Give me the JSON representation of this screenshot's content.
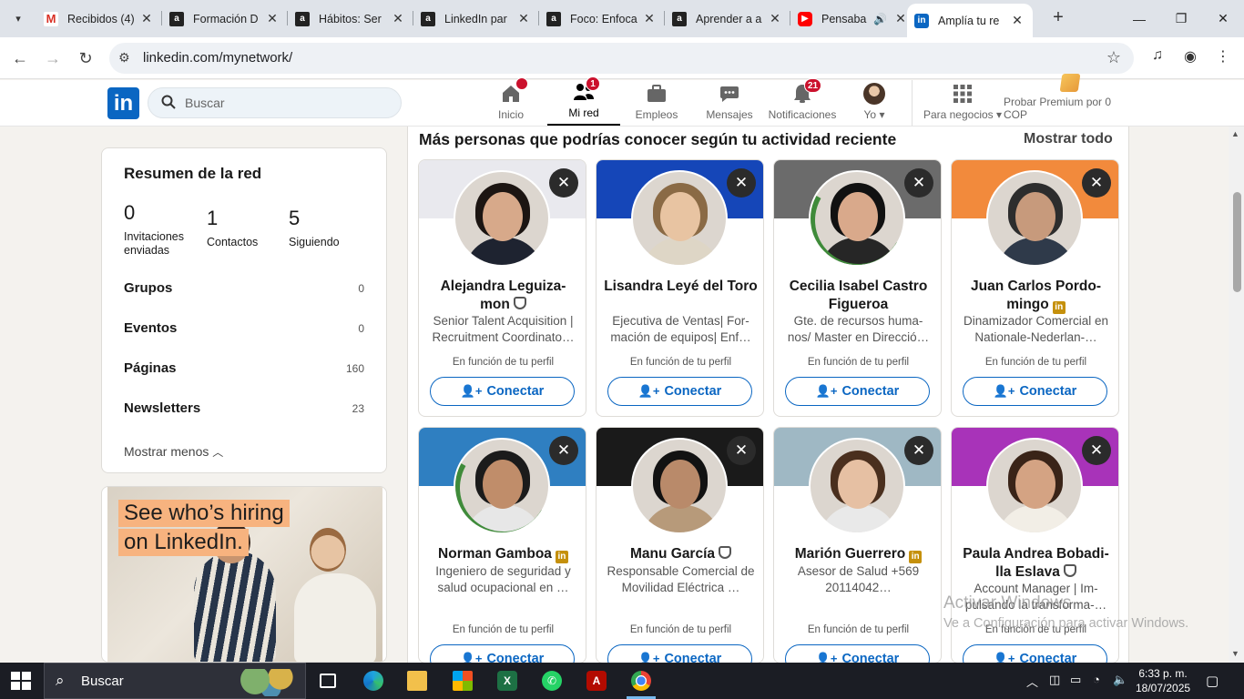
{
  "browser": {
    "tabs": [
      {
        "title": "Recibidos (4)",
        "favicon": "gmail-icon",
        "active": false
      },
      {
        "title": "Formación D",
        "favicon": "academia-icon",
        "active": false
      },
      {
        "title": "Hábitos: Ser",
        "favicon": "academia-icon",
        "active": false
      },
      {
        "title": "LinkedIn par",
        "favicon": "academia-icon",
        "active": false
      },
      {
        "title": "Foco: Enfoca",
        "favicon": "academia-icon",
        "active": false
      },
      {
        "title": "Aprender a a",
        "favicon": "academia-icon",
        "active": false
      },
      {
        "title": "Pensaba",
        "favicon": "youtube-icon",
        "active": false,
        "audio": true
      },
      {
        "title": "Amplía tu re",
        "favicon": "linkedin-icon",
        "active": true
      }
    ],
    "url": "linkedin.com/mynetwork/"
  },
  "linkedin_header": {
    "logo": "in",
    "search_placeholder": "Buscar",
    "nav": [
      {
        "label": "Inicio",
        "icon": "home-icon",
        "badge": "",
        "dot": true
      },
      {
        "label": "Mi red",
        "icon": "network-icon",
        "badge": "1",
        "active": true
      },
      {
        "label": "Empleos",
        "icon": "briefcase-icon",
        "badge": ""
      },
      {
        "label": "Mensajes",
        "icon": "messages-icon",
        "badge": ""
      },
      {
        "label": "Notificaciones",
        "icon": "bell-icon",
        "badge": "21"
      },
      {
        "label": "Yo",
        "icon": "avatar",
        "badge": ""
      }
    ],
    "business_label": "Para negocios",
    "premium_label": "Probar Premium por 0 COP"
  },
  "network_summary": {
    "title": "Resumen de la red",
    "stats": [
      {
        "value": "0",
        "label": "Invitaciones enviadas"
      },
      {
        "value": "1",
        "label": "Contactos"
      },
      {
        "value": "5",
        "label": "Siguiendo"
      }
    ],
    "rows": [
      {
        "label": "Grupos",
        "count": "0"
      },
      {
        "label": "Eventos",
        "count": "0"
      },
      {
        "label": "Páginas",
        "count": "160"
      },
      {
        "label": "Newsletters",
        "count": "23"
      }
    ],
    "show_less": "Mostrar menos"
  },
  "ad": {
    "line1": "See who’s hiring",
    "line2": "on LinkedIn."
  },
  "suggestions": {
    "title": "Más personas que podrías conocer según tu actividad reciente",
    "show_all": "Mostrar todo",
    "connect_label": "Conectar",
    "cards": [
      {
        "name": "Alejandra Leguiza-mon",
        "badge": "verified-shield-icon",
        "headline": "Senior Talent Acquisition | Recruitment Coordinato…",
        "basis": "En función de tu perfil",
        "banner": "#e9e9ee",
        "hair": "#1c1512",
        "skin": "#d7a98a",
        "body": "#1e2330",
        "otw": false
      },
      {
        "name": "Lisandra Leyé del Toro",
        "badge": "",
        "headline": "Ejecutiva de Ventas| For-mación de equipos| Enf…",
        "basis": "En función de tu perfil",
        "banner": "#1546b8",
        "hair": "#8a6a45",
        "skin": "#e8c4a2",
        "body": "#ded6c6",
        "otw": false
      },
      {
        "name": "Cecilia Isabel Castro Figueroa",
        "badge": "",
        "headline": "Gte. de recursos huma-nos/ Master en Direcció…",
        "basis": "En función de tu perfil",
        "banner": "#6b6b6b",
        "hair": "#111111",
        "skin": "#d9a98b",
        "body": "#262626",
        "otw": true
      },
      {
        "name": "Juan Carlos Pordo-mingo",
        "badge": "linkedin-premium-icon",
        "headline": "Dinamizador Comercial en Nationale-Nederlan-…",
        "basis": "En función de tu perfil",
        "banner": "#f28a3c",
        "hair": "#2d2d2d",
        "skin": "#c79a7c",
        "body": "#2f3a4a",
        "otw": false
      },
      {
        "name": "Norman Gamboa",
        "badge": "linkedin-premium-icon",
        "headline": "Ingeniero de seguridad y salud ocupacional en …",
        "basis": "En función de tu perfil",
        "banner": "#2f7fc1",
        "hair": "#1b1b1b",
        "skin": "#c08d6a",
        "body": "#e7e7e7",
        "otw": true
      },
      {
        "name": "Manu García",
        "badge": "verified-shield-icon",
        "headline": "Responsable Comercial de Movilidad Eléctrica …",
        "basis": "En función de tu perfil",
        "banner": "#1a1a1a",
        "hair": "#121212",
        "skin": "#b98a6a",
        "body": "#b79a7a",
        "otw": false
      },
      {
        "name": "Marión Guerrero",
        "badge": "linkedin-premium-icon",
        "headline": "Asesor de Salud +569 20114042…",
        "basis": "En función de tu perfil",
        "banner": "#9fb8c4",
        "hair": "#4a2f1e",
        "skin": "#e6c0a3",
        "body": "#e9e9e9",
        "otw": false
      },
      {
        "name": "Paula Andrea Bobadi-lla Eslava",
        "badge": "verified-shield-icon",
        "headline": "Account Manager | Im-pulsando la transforma-…",
        "basis": "En función de tu perfil",
        "banner": "#a833b9",
        "hair": "#3a2418",
        "skin": "#d4a383",
        "body": "#f2eee6",
        "otw": false
      }
    ]
  },
  "watermark": {
    "line1": "Activar Windows",
    "line2": "Ve a Configuración para activar Windows."
  },
  "taskbar": {
    "search_label": "Buscar",
    "time": "6:33 p. m.",
    "date": "18/07/2025"
  },
  "colors": {
    "linkedin_blue": "#0a66c2",
    "badge_red": "#cb112d"
  }
}
